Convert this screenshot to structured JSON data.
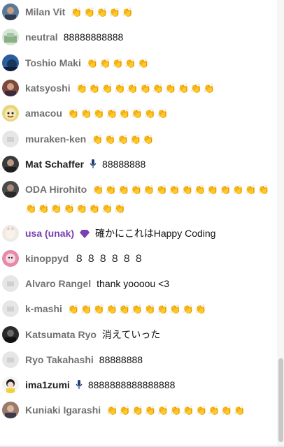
{
  "chat": {
    "messages": [
      {
        "author": "Milan Vit",
        "text": "👏👏👏👏👏",
        "avatar": "avatar-milan"
      },
      {
        "author": "neutral",
        "text": "88888888888",
        "avatar": "avatar-neutral"
      },
      {
        "author": "Toshio Maki",
        "text": "👏👏👏👏👏",
        "avatar": "avatar-toshio"
      },
      {
        "author": "katsyoshi",
        "text": "👏👏👏👏👏👏👏👏👏👏👏",
        "avatar": "avatar-katsyoshi"
      },
      {
        "author": "amacou",
        "text": "👏👏👏👏👏👏👏👏",
        "avatar": "avatar-amacou"
      },
      {
        "author": "muraken-ken",
        "text": "👏👏👏👏👏",
        "avatar": "avatar-default"
      },
      {
        "author": "Mat Schaffer",
        "text": "88888888",
        "avatar": "avatar-mat",
        "badge": "microphone-icon"
      },
      {
        "author": "ODA Hirohito",
        "text": "👏👏👏👏👏👏👏👏👏👏👏👏👏👏👏👏👏👏👏👏👏👏",
        "avatar": "avatar-oda"
      },
      {
        "author": "usa (unak)",
        "text": "確かにこれはHappy Coding",
        "avatar": "avatar-usa",
        "badge": "diamond-icon"
      },
      {
        "author": "kinoppyd",
        "text": "８８８８８８",
        "avatar": "avatar-kinoppyd"
      },
      {
        "author": "Alvaro Rangel",
        "text": "thank yoooou <3",
        "avatar": "avatar-default"
      },
      {
        "author": "k-mashi",
        "text": "👏👏👏👏👏👏👏👏👏👏👏",
        "avatar": "avatar-default"
      },
      {
        "author": "Katsumata Ryo",
        "text": "消えていった",
        "avatar": "avatar-katsumata"
      },
      {
        "author": "Ryo Takahashi",
        "text": "88888888",
        "avatar": "avatar-default"
      },
      {
        "author": "ima1zumi",
        "text": "8888888888888888",
        "avatar": "avatar-ima1zumi",
        "badge": "microphone-icon"
      },
      {
        "author": "Kuniaki Igarashi",
        "text": "👏👏👏👏👏👏👏👏👏👏👏",
        "avatar": "avatar-kuniaki"
      }
    ]
  },
  "colors": {
    "author_default": "#717171",
    "author_member_dark": "#202020",
    "author_purple": "#7a3fb2",
    "badge_blue": "#1f3f7a",
    "badge_purple": "#7a3fb2"
  }
}
